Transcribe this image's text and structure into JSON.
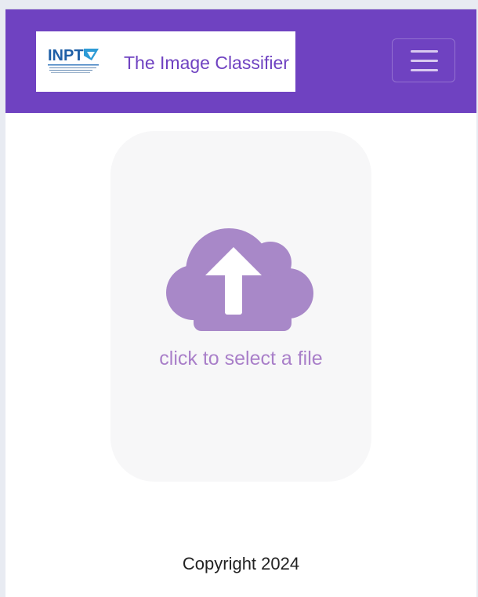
{
  "header": {
    "logo_text": "INPT",
    "title": "The Image Classifier",
    "menu_button": "toggle-navigation"
  },
  "upload": {
    "text": "click to select a file",
    "icon": "cloud-upload-icon"
  },
  "footer": {
    "copyright": "Copyright 2024"
  },
  "colors": {
    "navbar": "#6f42c1",
    "accent": "#a97fc9",
    "upload_bg": "#f7f7f8"
  }
}
